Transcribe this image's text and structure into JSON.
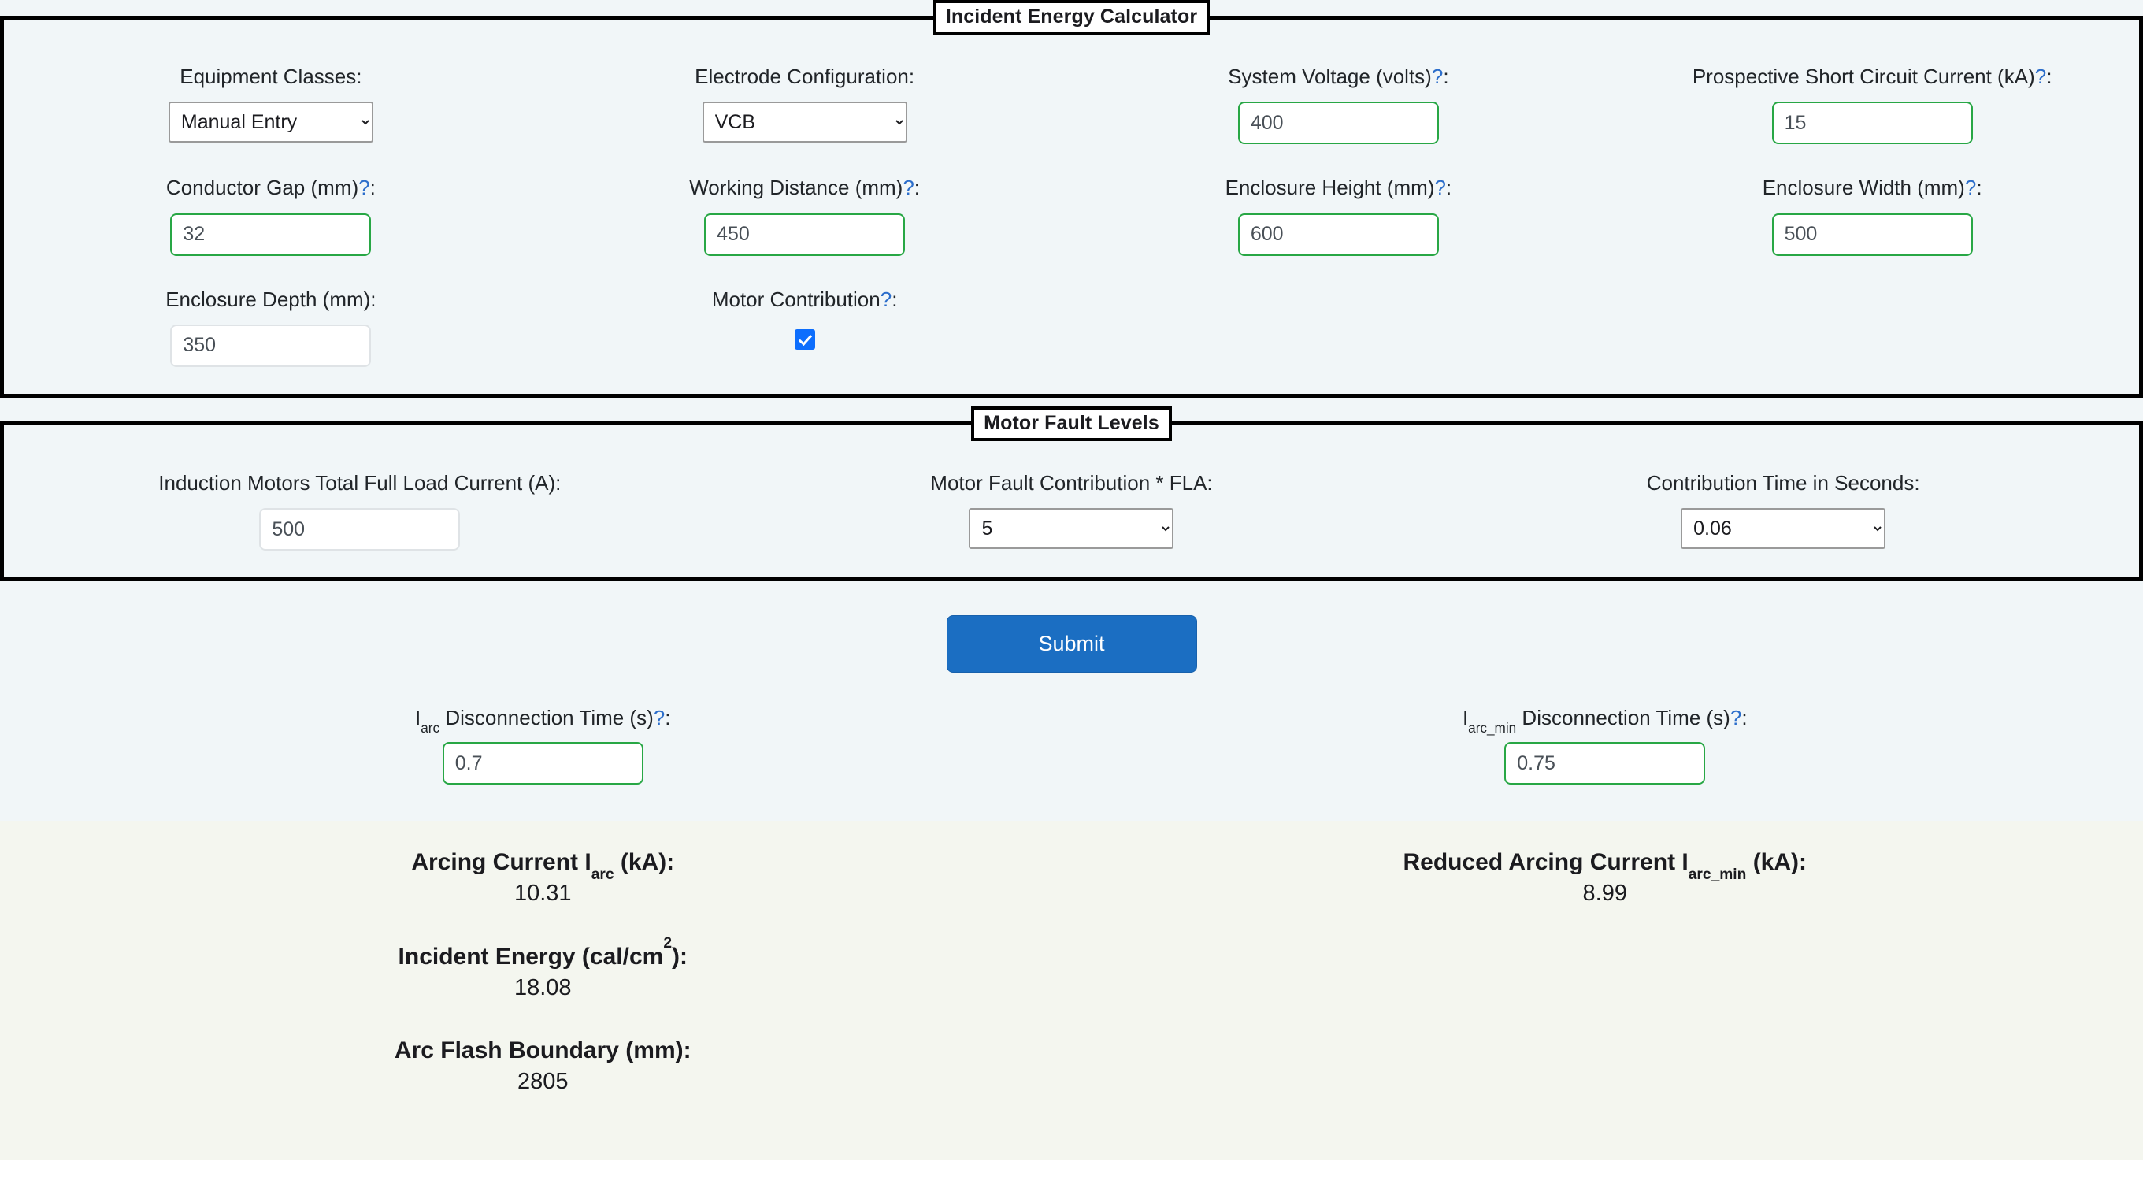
{
  "panels": {
    "incident": {
      "legend": "Incident Energy Calculator",
      "fields": {
        "equipment_classes": {
          "label": "Equipment Classes:",
          "value": "Manual Entry",
          "options": [
            "Manual Entry"
          ]
        },
        "electrode_config": {
          "label": "Electrode Configuration:",
          "value": "VCB",
          "options": [
            "VCB"
          ]
        },
        "system_voltage": {
          "label": "System Voltage (volts)",
          "help": "?",
          "suffix": ":",
          "value": "400"
        },
        "short_circuit": {
          "label": "Prospective Short Circuit Current (kA)",
          "help": "?",
          "suffix": ":",
          "value": "15"
        },
        "conductor_gap": {
          "label": "Conductor Gap (mm)",
          "help": "?",
          "suffix": ":",
          "value": "32"
        },
        "working_distance": {
          "label": "Working Distance (mm)",
          "help": "?",
          "suffix": ":",
          "value": "450"
        },
        "enclosure_height": {
          "label": "Enclosure Height (mm)",
          "help": "?",
          "suffix": ":",
          "value": "600"
        },
        "enclosure_width": {
          "label": "Enclosure Width (mm)",
          "help": "?",
          "suffix": ":",
          "value": "500"
        },
        "enclosure_depth": {
          "label": "Enclosure Depth (mm):",
          "value": "350"
        },
        "motor_contribution": {
          "label": "Motor Contribution",
          "help": "?",
          "suffix": ":",
          "checked": true
        }
      }
    },
    "motor": {
      "legend": "Motor Fault Levels",
      "fields": {
        "induction_fla": {
          "label": "Induction Motors Total Full Load Current (A):",
          "value": "500"
        },
        "fault_multiple": {
          "label": "Motor Fault Contribution * FLA:",
          "value": "5",
          "options": [
            "5"
          ]
        },
        "contrib_time": {
          "label": "Contribution Time in Seconds:",
          "value": "0.06",
          "options": [
            "0.06"
          ]
        }
      }
    }
  },
  "submit": {
    "label": "Submit"
  },
  "disconnection": {
    "iarc": {
      "label_pre": "I",
      "label_sub": "arc",
      "label_post": " Disconnection Time (s)",
      "help": "?",
      "suffix": ":",
      "value": "0.7"
    },
    "iarc_min": {
      "label_pre": "I",
      "label_sub": "arc_min",
      "label_post": " Disconnection Time (s)",
      "help": "?",
      "suffix": ":",
      "value": "0.75"
    }
  },
  "results": {
    "arcing_current": {
      "title_pre": "Arcing Current I",
      "title_sub": "arc",
      "title_post": " (kA):",
      "value": "10.31"
    },
    "reduced_arcing_current": {
      "title_pre": "Reduced Arcing Current I",
      "title_sub": "arc_min",
      "title_post": " (kA):",
      "value": "8.99"
    },
    "incident_energy": {
      "title_pre": "Incident Energy (cal/cm",
      "title_sup": "2",
      "title_post": "):",
      "value": "18.08"
    },
    "arc_flash_boundary": {
      "title_pre": "Arc Flash Boundary (mm):",
      "title_sub": "",
      "title_post": "",
      "value": "2805"
    }
  },
  "colors": {
    "form_background": "#f1f6f8",
    "results_background": "#f4f6ef",
    "panel_border": "#000000",
    "input_valid_border": "#28a745",
    "submit_background": "#1b6ec2",
    "help_marker": "#2c6ecb",
    "checkbox_checked": "#0d6efd"
  }
}
